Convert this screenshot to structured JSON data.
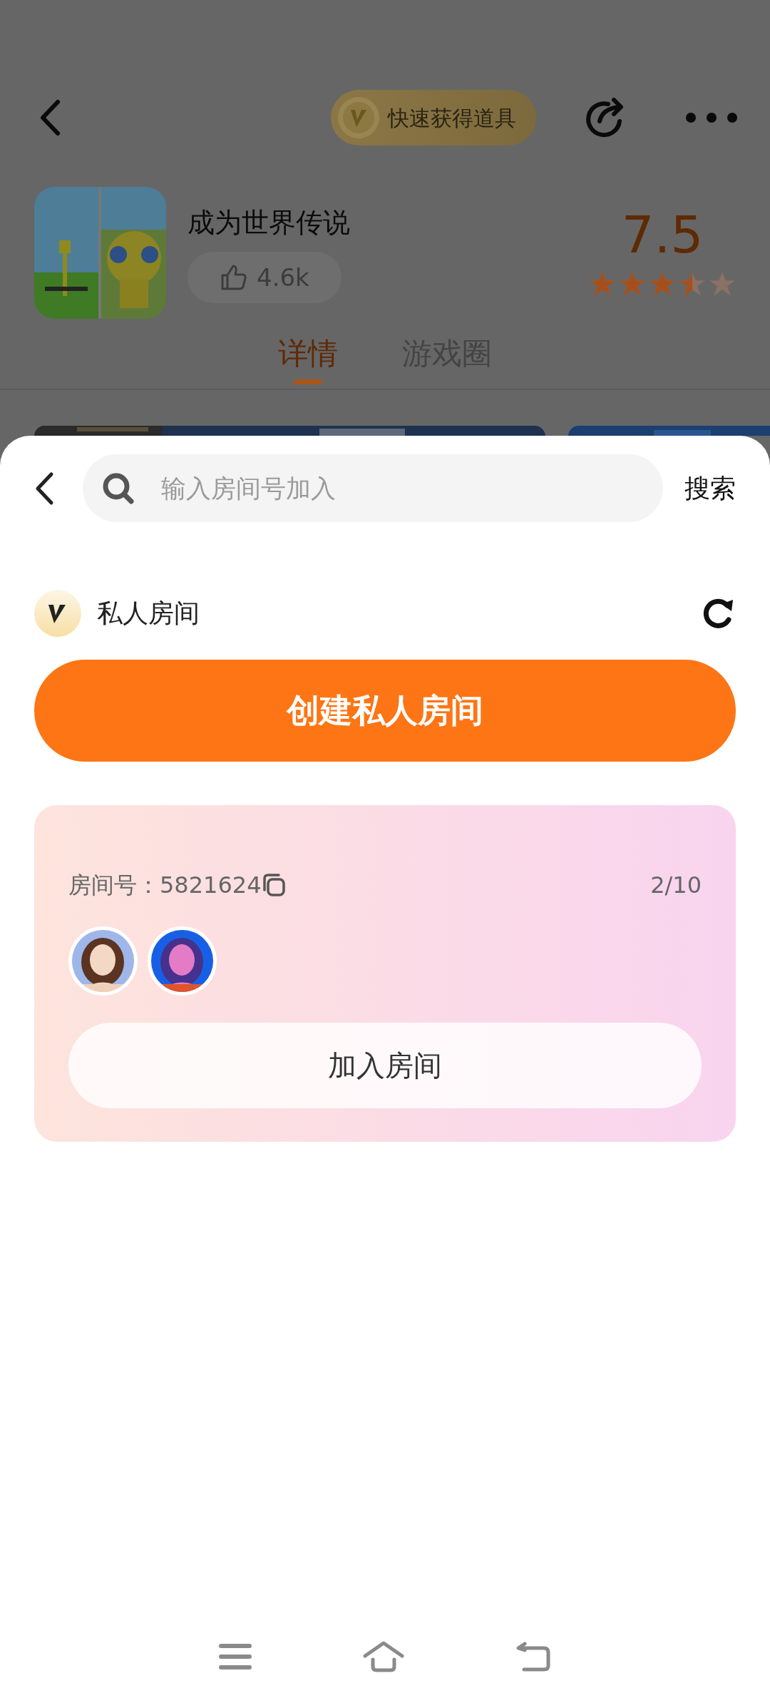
{
  "header": {
    "promo_badge": "快速获得道具"
  },
  "game": {
    "title": "成为世界传说",
    "likes": "4.6k",
    "score": "7.5",
    "stars": 3.5
  },
  "tabs": [
    {
      "label": "详情",
      "selected": true
    },
    {
      "label": "游戏圈",
      "selected": false
    }
  ],
  "sheet": {
    "search": {
      "placeholder": "输入房间号加入"
    },
    "search_button": "搜索",
    "section_title": "私人房间",
    "create_button": "创建私人房间",
    "rooms": [
      {
        "room_number": "房间号：5821624",
        "occupancy": "2/10",
        "join_button": "加入房间"
      }
    ]
  }
}
